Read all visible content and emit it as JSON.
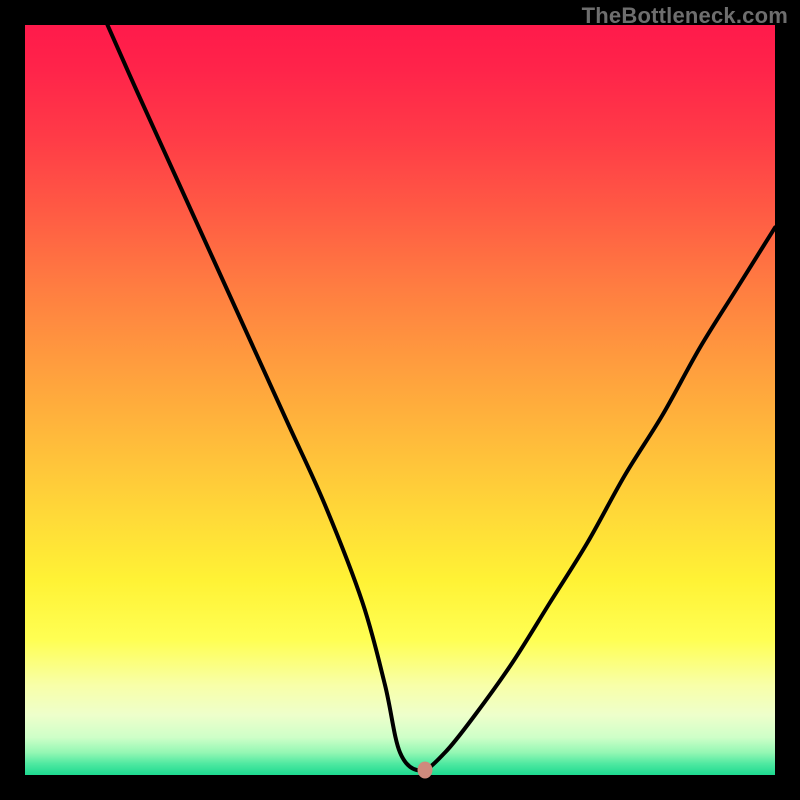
{
  "watermark": {
    "text": "TheBottleneck.com"
  },
  "marker": {
    "color": "#cf8a7d",
    "x_pct": 53.3,
    "y_pct": 99.3
  },
  "gradient_stops": [
    {
      "offset": 0.0,
      "color": "#ff1a4b"
    },
    {
      "offset": 0.06,
      "color": "#ff244a"
    },
    {
      "offset": 0.15,
      "color": "#ff3b47"
    },
    {
      "offset": 0.25,
      "color": "#ff5b44"
    },
    {
      "offset": 0.35,
      "color": "#ff7d41"
    },
    {
      "offset": 0.45,
      "color": "#ff9c3e"
    },
    {
      "offset": 0.55,
      "color": "#ffba3b"
    },
    {
      "offset": 0.65,
      "color": "#ffd838"
    },
    {
      "offset": 0.74,
      "color": "#fff235"
    },
    {
      "offset": 0.82,
      "color": "#ffff53"
    },
    {
      "offset": 0.88,
      "color": "#f8ffa8"
    },
    {
      "offset": 0.92,
      "color": "#eeffcb"
    },
    {
      "offset": 0.95,
      "color": "#ceffc8"
    },
    {
      "offset": 0.97,
      "color": "#94f7b4"
    },
    {
      "offset": 0.985,
      "color": "#4fe9a1"
    },
    {
      "offset": 1.0,
      "color": "#1dd990"
    }
  ],
  "chart_data": {
    "type": "line",
    "title": "",
    "xlabel": "",
    "ylabel": "",
    "xlim": [
      0,
      100
    ],
    "ylim": [
      0,
      100
    ],
    "grid": false,
    "legend": false,
    "series": [
      {
        "name": "bottleneck-curve",
        "x": [
          11,
          15,
          20,
          25,
          30,
          35,
          40,
          45,
          48,
          50,
          52.8,
          56,
          60,
          65,
          70,
          75,
          80,
          85,
          90,
          95,
          100
        ],
        "y": [
          100,
          91,
          80,
          69,
          58,
          47,
          36,
          23,
          12,
          3,
          0.6,
          3,
          8,
          15,
          23,
          31,
          40,
          48,
          57,
          65,
          73
        ]
      }
    ],
    "annotations": [
      {
        "type": "marker",
        "x": 53.3,
        "y": 0.7,
        "color": "#cf8a7d"
      }
    ],
    "background_gradient": "vertical red→orange→yellow→green"
  }
}
